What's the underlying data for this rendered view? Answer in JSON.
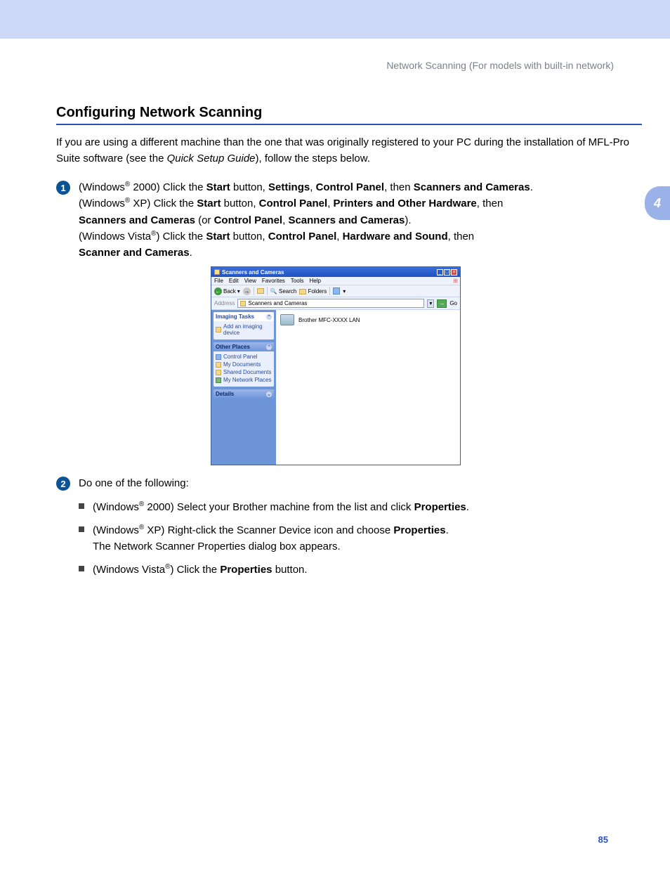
{
  "header": {
    "section": "Network Scanning (For models with built-in network)"
  },
  "chapter_tab": "4",
  "page_number": "85",
  "title": "Configuring Network Scanning",
  "intro": {
    "p1a": "If you are using a different machine than the one that was originally registered to your PC during the installation of MFL-Pro Suite software (see the ",
    "p1_quick": "Quick Setup Guide",
    "p1b": "), follow the steps below."
  },
  "step1": {
    "num": "1",
    "win2000_a": "(Windows",
    "reg": "®",
    "win2000_b": " 2000) Click the ",
    "start": "Start",
    "btn": " button, ",
    "settings": "Settings",
    "comma": ", ",
    "cp": "Control Panel",
    "then": ", then ",
    "sc": "Scanners and Cameras",
    "period": ".",
    "xp_a": "(Windows",
    "xp_b": " XP) Click the ",
    "poh": "Printers and Other Hardware",
    "then2": ", then",
    "or": " (or ",
    "closep": ").",
    "vista_a": "(Windows Vista",
    "vista_b": ") Click the ",
    "hs": "Hardware and Sound",
    "scsingular": "Scanner and Cameras"
  },
  "screenshot": {
    "title": "Scanners and Cameras",
    "menu": {
      "file": "File",
      "edit": "Edit",
      "view": "View",
      "favorites": "Favorites",
      "tools": "Tools",
      "help": "Help"
    },
    "toolbar": {
      "back": "Back",
      "search": "Search",
      "folders": "Folders"
    },
    "address_label": "Address",
    "address_value": "Scanners and Cameras",
    "go": "Go",
    "side": {
      "imaging_tasks": "Imaging Tasks",
      "add_device": "Add an imaging device",
      "other_places": "Other Places",
      "cp": "Control Panel",
      "mydocs": "My Documents",
      "shared": "Shared Documents",
      "netplaces": "My Network Places",
      "details": "Details"
    },
    "device_name": "Brother MFC-XXXX LAN"
  },
  "step2": {
    "num": "2",
    "lead": "Do one of the following:",
    "b1_a": "(Windows",
    "b1_b": " 2000) Select your Brother machine from the list and click ",
    "props": "Properties",
    "b2_a": "(Windows",
    "b2_b": " XP) Right-click the Scanner Device icon and choose ",
    "b2_c": "The Network Scanner Properties dialog box appears.",
    "b3_a": "(Windows Vista",
    "b3_b": ") Click the ",
    "b3_c": " button."
  }
}
